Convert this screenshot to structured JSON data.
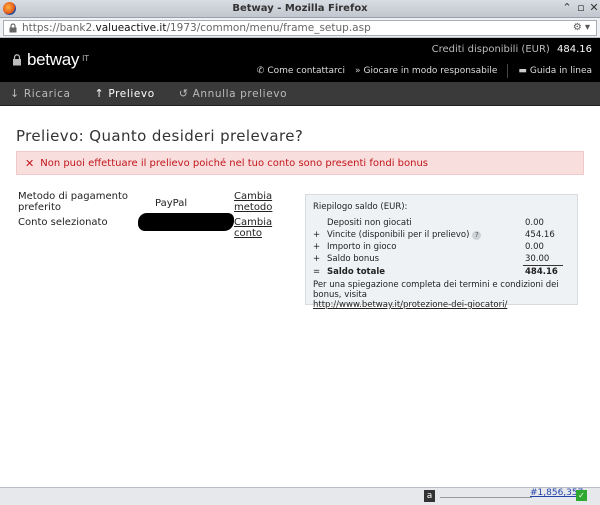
{
  "window": {
    "title": "Betway - Mozilla Firefox"
  },
  "urlbar": {
    "prefix": "https://bank2.",
    "host": "valueactive.it",
    "path": "/1973/common/menu/frame_setup.asp"
  },
  "header": {
    "brand": "betway",
    "tld": "IT",
    "credits_label": "Crediti disponibili (EUR)",
    "credits_value": "484.16",
    "links": [
      {
        "label": "Come contattarci",
        "icon": "phone-icon"
      },
      {
        "label": "Giocare in modo responsabile",
        "icon": "double-chevron-icon"
      },
      {
        "label": "Guida in linea",
        "icon": "chat-bubble-icon"
      }
    ]
  },
  "nav": {
    "tabs": [
      {
        "label": "Ricarica",
        "icon": "arrow-down-icon",
        "active": false
      },
      {
        "label": "Prelievo",
        "icon": "arrow-up-icon",
        "active": true
      },
      {
        "label": "Annulla prelievo",
        "icon": "undo-icon",
        "active": false
      }
    ]
  },
  "main": {
    "title": "Prelievo: Quanto desideri prelevare?",
    "alert": "Non puoi effettuare il prelievo poiché nel tuo conto sono presenti fondi bonus",
    "payment_method_label": "Metodo di pagamento preferito",
    "payment_method_value": "PayPal",
    "change_method_link": "Cambia metodo",
    "selected_account_label": "Conto selezionato",
    "change_account_link": "Cambia conto"
  },
  "balance": {
    "title": "Riepilogo saldo (EUR):",
    "rows": [
      {
        "op": "",
        "label": "Depositi non giocati",
        "value": "0.00"
      },
      {
        "op": "+",
        "label": "Vincite (disponibili per il prelievo)",
        "value": "454.16"
      },
      {
        "op": "+",
        "label": "Importo in gioco",
        "value": "0.00"
      },
      {
        "op": "+",
        "label": "Saldo bonus",
        "value": "30.00"
      },
      {
        "op": "=",
        "label": "Saldo totale",
        "value": "484.16"
      }
    ],
    "note": "Per una spiegazione completa dei termini e condizioni dei bonus, visita",
    "note_url": "http://www.betway.it/protezione-dei-giocatori/"
  },
  "statusbar": {
    "counter": "#1,856,357"
  },
  "colors": {
    "header_bg": "#000000",
    "nav_bg": "#3a3a3a",
    "alert_bg": "#f9dede",
    "alert_text": "#c0151a",
    "balance_bg": "#eef2f4"
  }
}
